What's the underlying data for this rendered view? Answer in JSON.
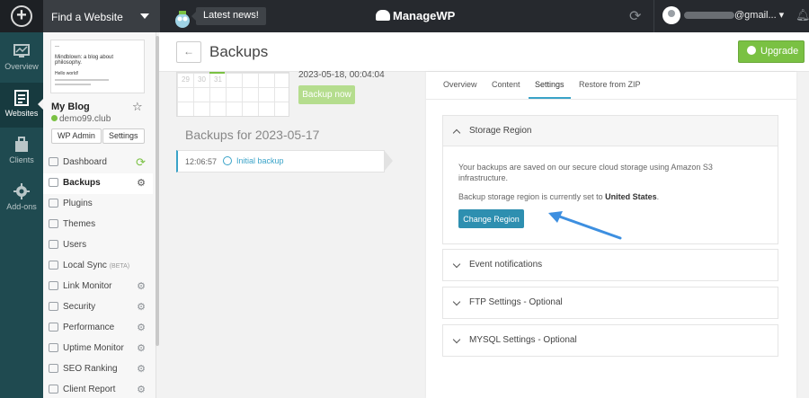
{
  "topbar": {
    "find_site": "Find a Website",
    "news": "Latest news!",
    "brand": "ManageWP",
    "user_email": "@gmail..."
  },
  "rail": {
    "items": [
      {
        "label": "Overview",
        "icon": "overview-icon"
      },
      {
        "label": "Websites",
        "icon": "websites-icon"
      },
      {
        "label": "Clients",
        "icon": "clients-icon"
      },
      {
        "label": "Add-ons",
        "icon": "addons-icon"
      }
    ]
  },
  "site": {
    "thumb_line1": "Mindblown: a blog about philosophy.",
    "thumb_line2": "Hello world!",
    "name": "My Blog",
    "url": "demo99.club",
    "wp_admin": "WP Admin",
    "settings": "Settings"
  },
  "menu": {
    "items": [
      {
        "label": "Dashboard"
      },
      {
        "label": "Backups"
      },
      {
        "label": "Plugins"
      },
      {
        "label": "Themes"
      },
      {
        "label": "Users"
      },
      {
        "label": "Local Sync",
        "badge": "(BETA)"
      },
      {
        "label": "Link Monitor"
      },
      {
        "label": "Security"
      },
      {
        "label": "Performance"
      },
      {
        "label": "Uptime Monitor"
      },
      {
        "label": "SEO Ranking"
      },
      {
        "label": "Client Report"
      }
    ]
  },
  "page": {
    "title": "Backups",
    "upgrade": "Upgrade"
  },
  "calendar": {
    "numbers": [
      "29",
      "30",
      "31"
    ]
  },
  "backups": {
    "last_backup_time": "2023-05-18, 00:04:04",
    "backup_now": "Backup now",
    "list_title": "Backups for 2023-05-17",
    "rows": [
      {
        "time": "12:06:57",
        "label": "Initial backup"
      }
    ]
  },
  "settings": {
    "tabs": [
      "Overview",
      "Content",
      "Settings",
      "Restore from ZIP"
    ],
    "active_tab": "Settings",
    "storage": {
      "title": "Storage Region",
      "text1": "Your backups are saved on our secure cloud storage using Amazon S3 infrastructure.",
      "text2_prefix": "Backup storage region is currently set to ",
      "region": "United States",
      "text2_suffix": ".",
      "button": "Change Region"
    },
    "sections": [
      "Event notifications",
      "FTP Settings - Optional",
      "MYSQL Settings - Optional"
    ]
  },
  "colors": {
    "accent": "#3aa3c8",
    "green": "#7ac143",
    "button_blue": "#2e8fb0",
    "rail": "#1f4a50",
    "topbar": "#26292e"
  }
}
